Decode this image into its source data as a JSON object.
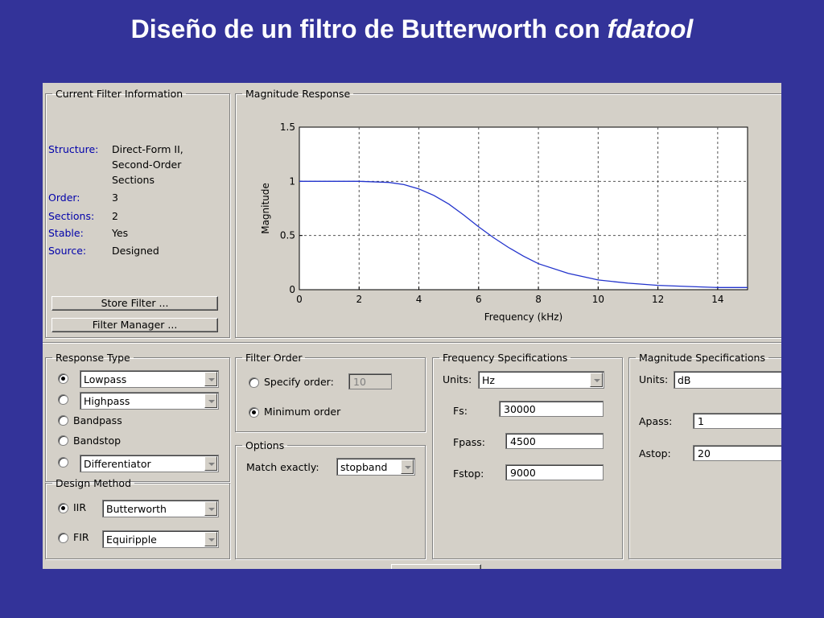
{
  "slide": {
    "title": "Diseño de un filtro de Butterworth con",
    "title_italic": "fdatool"
  },
  "filter_info": {
    "legend": "Current Filter Information",
    "structure_label": "Structure:",
    "structure_lines": [
      "Direct-Form II,",
      "Second-Order",
      "Sections"
    ],
    "order_label": "Order:",
    "order_value": "3",
    "sections_label": "Sections:",
    "sections_value": "2",
    "stable_label": "Stable:",
    "stable_value": "Yes",
    "source_label": "Source:",
    "source_value": "Designed",
    "store_button": "Store Filter ...",
    "manager_button": "Filter Manager ..."
  },
  "magnitude_response": {
    "legend": "Magnitude Response"
  },
  "chart_data": {
    "type": "line",
    "xlabel": "Frequency (kHz)",
    "ylabel": "Magnitude",
    "xlim": [
      0,
      15
    ],
    "ylim": [
      0,
      1.5
    ],
    "xticks": [
      "0",
      "2",
      "4",
      "6",
      "8",
      "10",
      "12",
      "14"
    ],
    "yticks": [
      "0",
      "0.5",
      "1",
      "1.5"
    ],
    "grid": true,
    "series": [
      {
        "color": "#2233cc",
        "x": [
          0,
          1,
          2,
          3,
          3.5,
          4,
          4.5,
          5,
          5.5,
          6,
          6.5,
          7,
          7.5,
          8,
          9,
          10,
          11,
          12,
          13,
          14,
          15
        ],
        "y": [
          1,
          1,
          1,
          0.99,
          0.97,
          0.93,
          0.87,
          0.79,
          0.69,
          0.58,
          0.48,
          0.39,
          0.31,
          0.24,
          0.15,
          0.09,
          0.06,
          0.04,
          0.03,
          0.02,
          0.02
        ]
      }
    ]
  },
  "response_type": {
    "legend": "Response Type",
    "lowpass": "Lowpass",
    "highpass": "Highpass",
    "bandpass": "Bandpass",
    "bandstop": "Bandstop",
    "differentiator": "Differentiator"
  },
  "design_method": {
    "legend": "Design Method",
    "iir_label": "IIR",
    "iir_value": "Butterworth",
    "fir_label": "FIR",
    "fir_value": "Equiripple"
  },
  "filter_order": {
    "legend": "Filter Order",
    "specify_label": "Specify order:",
    "specify_value": "10",
    "minimum_label": "Minimum order"
  },
  "options": {
    "legend": "Options",
    "match_label": "Match exactly:",
    "match_value": "stopband"
  },
  "freq_specs": {
    "legend": "Frequency Specifications",
    "units_label": "Units:",
    "units_value": "Hz",
    "fs_label": "Fs:",
    "fs_value": "30000",
    "fpass_label": "Fpass:",
    "fpass_value": "4500",
    "fstop_label": "Fstop:",
    "fstop_value": "9000"
  },
  "mag_specs": {
    "legend": "Magnitude Specifications",
    "units_label": "Units:",
    "units_value": "dB",
    "apass_label": "Apass:",
    "apass_value": "1",
    "astop_label": "Astop:",
    "astop_value": "20"
  }
}
